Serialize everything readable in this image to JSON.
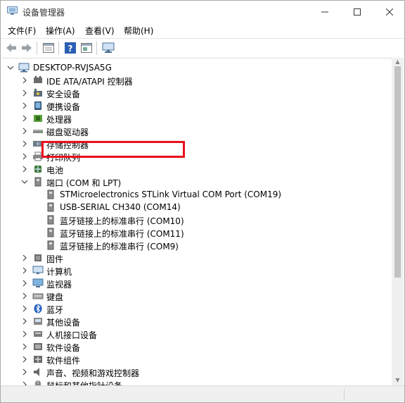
{
  "window": {
    "title": "设备管理器"
  },
  "menu": [
    "文件(F)",
    "操作(A)",
    "查看(V)",
    "帮助(H)"
  ],
  "toolbar": {
    "buttons": [
      "back-icon",
      "forward-icon",
      "properties-icon",
      "help-icon",
      "show-hidden-icon",
      "monitor-icon"
    ]
  },
  "tree": {
    "root": "DESKTOP-RVJSA5G",
    "categories_top": [
      {
        "label": "IDE ATA/ATAPI 控制器",
        "icon": "ide-controller-icon"
      },
      {
        "label": "安全设备",
        "icon": "security-device-icon"
      },
      {
        "label": "便携设备",
        "icon": "portable-device-icon"
      },
      {
        "label": "处理器",
        "icon": "processor-icon"
      },
      {
        "label": "磁盘驱动器",
        "icon": "disk-drive-icon"
      },
      {
        "label": "存储控制器",
        "icon": "storage-controller-icon"
      },
      {
        "label": "打印队列",
        "icon": "printer-icon"
      },
      {
        "label": "电池",
        "icon": "battery-icon"
      }
    ],
    "ports": {
      "label": "端口 (COM 和 LPT)",
      "children": [
        "STMicroelectronics STLink Virtual COM Port (COM19)",
        "USB-SERIAL CH340 (COM14)",
        "蓝牙链接上的标准串行 (COM10)",
        "蓝牙链接上的标准串行 (COM11)",
        "蓝牙链接上的标准串行 (COM9)"
      ]
    },
    "categories_bottom": [
      {
        "label": "固件",
        "icon": "firmware-icon"
      },
      {
        "label": "计算机",
        "icon": "computer-icon"
      },
      {
        "label": "监视器",
        "icon": "monitor-icon"
      },
      {
        "label": "键盘",
        "icon": "keyboard-icon"
      },
      {
        "label": "蓝牙",
        "icon": "bluetooth-icon"
      },
      {
        "label": "其他设备",
        "icon": "other-device-icon"
      },
      {
        "label": "人机接口设备",
        "icon": "hid-icon"
      },
      {
        "label": "软件设备",
        "icon": "software-device-icon"
      },
      {
        "label": "软件组件",
        "icon": "software-component-icon"
      },
      {
        "label": "声音、视频和游戏控制器",
        "icon": "audio-icon"
      },
      {
        "label": "鼠标和其他指针设备",
        "icon": "mouse-icon"
      }
    ]
  },
  "colors": {
    "highlight": "#e8101d",
    "accent": "#2b6cc4"
  }
}
